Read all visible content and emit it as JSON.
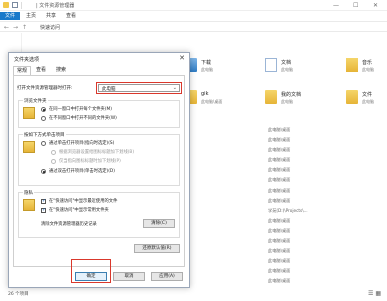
{
  "window": {
    "title": "| 文件资源管理器",
    "ribbon_tabs": [
      "文件",
      "主页",
      "共享",
      "查看"
    ],
    "address": "快速访问",
    "status": "26 个项目",
    "min": "—",
    "max": "☐",
    "close": "✕"
  },
  "tiles": [
    {
      "label": "下载",
      "sub": "此电脑"
    },
    {
      "label": "文档",
      "sub": "此电脑"
    },
    {
      "label": "gik",
      "sub": "此电脑\\桌面"
    },
    {
      "label": "我的文档",
      "sub": "此电脑"
    },
    {
      "label": "音乐",
      "sub": "此电脑"
    },
    {
      "label": "文件",
      "sub": "此电脑"
    },
    {
      "label": "图片",
      "sub": "此电脑"
    },
    {
      "label": "桌面",
      "sub": "此电脑"
    }
  ],
  "recent_items": [
    "此电脑\\桌面",
    "此电脑\\桌面",
    "此电脑\\桌面",
    "此电脑\\桌面",
    "此电脑\\桌面",
    "此电脑\\桌面",
    "此电脑\\桌面",
    "此电脑\\桌面",
    "学苑(D:)\\Projects\\...",
    "此电脑\\桌面",
    "此电脑\\桌面",
    "此电脑\\桌面",
    "此电脑\\桌面",
    "此电脑\\桌面",
    "此电脑\\桌面",
    "此电脑\\桌面"
  ],
  "dialog": {
    "title": "文件夹选项",
    "close": "✕",
    "tabs": [
      "常规",
      "查看",
      "搜索"
    ],
    "open_explorer_label": "打开文件资源管理器时打开:",
    "open_explorer_value": "此电脑",
    "browse_group_title": "浏览文件夹",
    "browse_same": "在同一窗口中打开每个文件夹(M)",
    "browse_new": "在不同窗口中打开不同的文件夹(W)",
    "click_group_title": "按如下方式单击项目",
    "click_single": "通过单击打开项目(指向时选定)(S)",
    "click_underline_all": "根据浏览器设置给图标标题加下划线(B)",
    "click_underline_hover": "仅当指向图标标题时加下划线(P)",
    "click_double": "通过双击打开项目(单击时选定)(D)",
    "privacy_group_title": "隐私",
    "privacy_recent": "在\"快速访问\"中显示最近使用的文件",
    "privacy_frequent": "在\"快速访问\"中显示常用文件夹",
    "clear_history_label": "清除文件资源管理器历史记录",
    "clear_button": "清除(C)",
    "restore_button": "还原默认值(R)",
    "ok_button": "确定",
    "cancel_button": "取消",
    "apply_button": "应用(A)"
  }
}
